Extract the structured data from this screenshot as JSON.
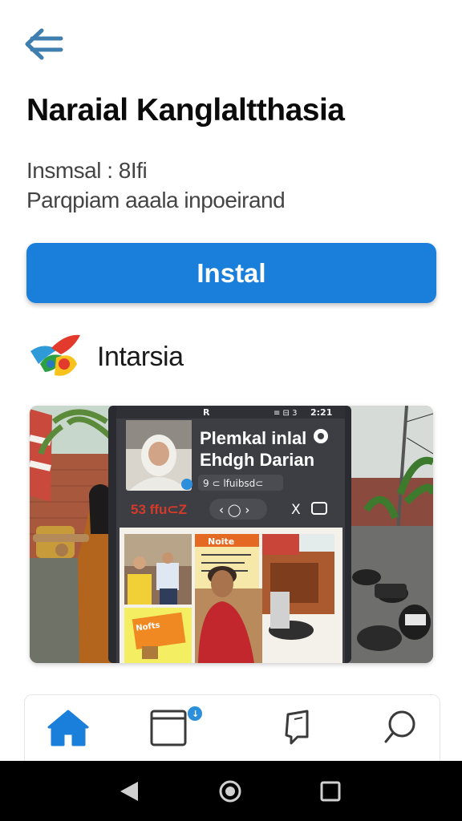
{
  "app": {
    "title": "Naraial Kanglaltthasia",
    "meta_line1": "Insmsal : 8Ifi",
    "meta_line2": "Parqpiam aaala inpoeirand",
    "install_label": "Instal"
  },
  "developer": {
    "name": "Intarsia"
  },
  "screenshot": {
    "status_icons": "≡ ⊟ 3",
    "status_time": "2:21",
    "heading_line1": "Plemkal inlal",
    "heading_line2": "Ehdgh Darian",
    "sub": "9 ⊂ lfuibsd⊂",
    "brand": "53 ffu⊂Z",
    "pill": "‹ ◯ ›",
    "poster": "Nofts"
  },
  "icons": {
    "back": "back-arrow-icon",
    "logo": "app-logo-icon",
    "home": "home-icon",
    "apps": "apps-icon",
    "books": "bookmark-icon",
    "search": "search-icon",
    "sys_back": "triangle-back-icon",
    "sys_home": "circle-home-icon",
    "sys_recent": "square-recent-icon"
  },
  "colors": {
    "accent": "#1a7fdb",
    "nav_active": "#1a7fdb",
    "system_bar": "#000000"
  }
}
